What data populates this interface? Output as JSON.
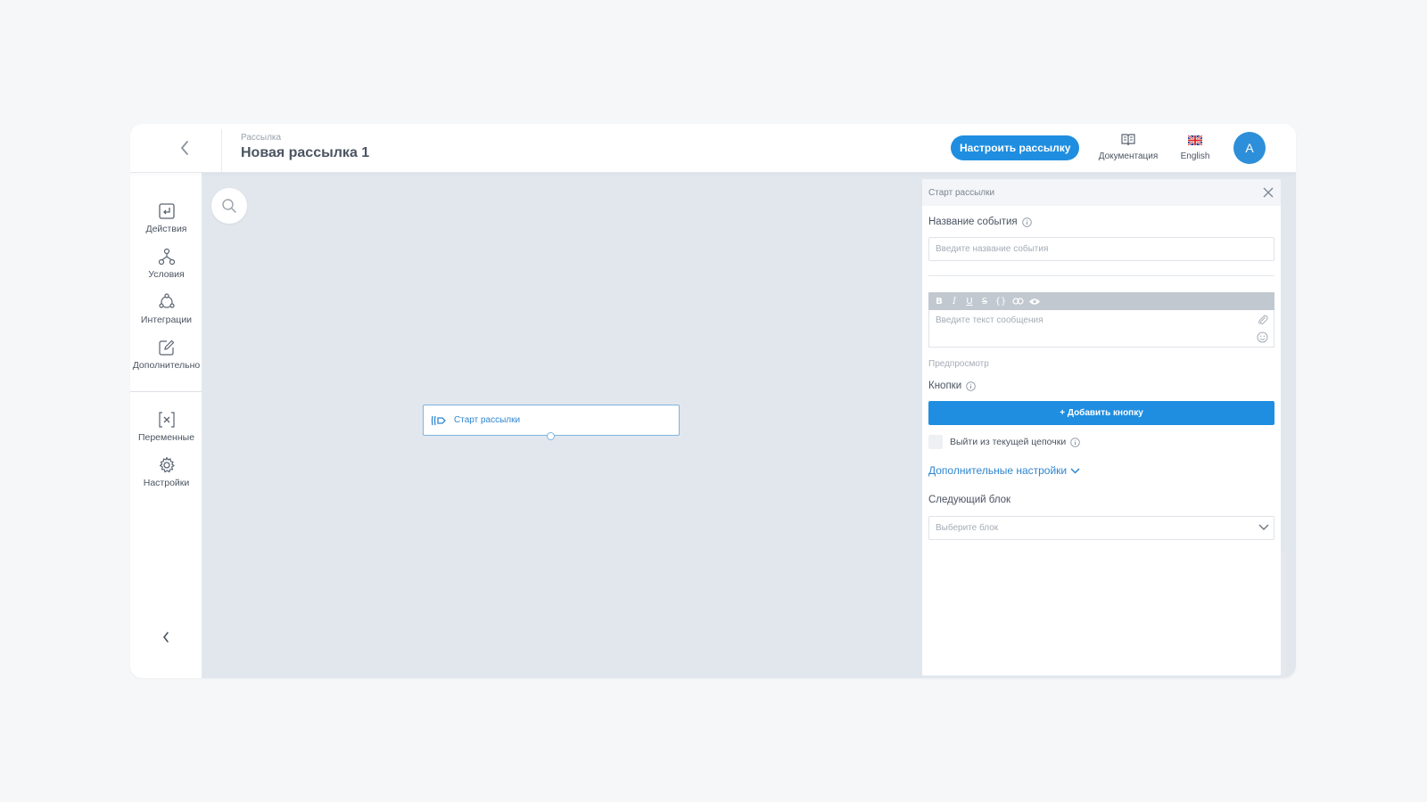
{
  "header": {
    "breadcrumb": "Рассылка",
    "title": "Новая рассылка 1",
    "cta_label": "Настроить рассылку",
    "docs_label": "Документация",
    "lang_label": "English",
    "avatar_letter": "A"
  },
  "sidebar": {
    "items": [
      {
        "label": "Действия",
        "icon": "actions-icon"
      },
      {
        "label": "Условия",
        "icon": "conditions-icon"
      },
      {
        "label": "Интеграции",
        "icon": "integrations-icon"
      },
      {
        "label": "Дополнительно",
        "icon": "edit-icon"
      },
      {
        "label": "Переменные",
        "icon": "variables-icon"
      },
      {
        "label": "Настройки",
        "icon": "gear-icon"
      }
    ]
  },
  "canvas": {
    "node_label": "Старт рассылки"
  },
  "panel": {
    "title": "Старт рассылки",
    "event_name_label": "Название события",
    "event_name_placeholder": "Введите название события",
    "toolbar": [
      "B",
      "I",
      "U",
      "S",
      "{}",
      "link",
      "eye"
    ],
    "message_placeholder": "Введите текст сообщения",
    "preview_label": "Предпросмотр",
    "buttons_label": "Кнопки",
    "add_button_label": "+ Добавить кнопку",
    "exit_chain_label": "Выйти из текущей цепочки",
    "advanced_label": "Дополнительные настройки",
    "next_block_label": "Следующий блок",
    "next_block_placeholder": "Выберите блок"
  },
  "colors": {
    "accent": "#1f8ee0",
    "canvas_bg": "#e2e7ee",
    "link": "#2f86cf"
  }
}
